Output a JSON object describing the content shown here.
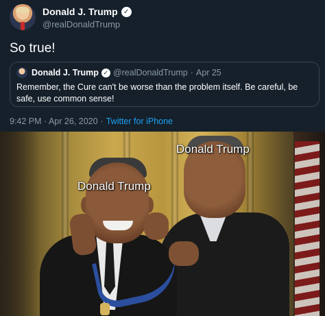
{
  "tweet": {
    "display_name": "Donald J. Trump",
    "handle": "@realDonaldTrump",
    "text": "So true!",
    "timestamp": "9:42 PM · Apr 26, 2020",
    "source": "Twitter for iPhone",
    "verified_icon": "✓"
  },
  "quoted_tweet": {
    "display_name": "Donald J. Trump",
    "handle": "@realDonaldTrump",
    "separator": "·",
    "date": "Apr 25",
    "text": "Remember, the Cure can't be worse than the problem itself. Be careful, be safe, use common sense!",
    "verified_icon": "✓"
  },
  "meme": {
    "label_right": "Donald Trump",
    "label_left": "Donald Trump"
  },
  "colors": {
    "background": "#15202b",
    "secondary_text": "#8899a6",
    "link": "#1da1f2",
    "border": "#38444d"
  }
}
